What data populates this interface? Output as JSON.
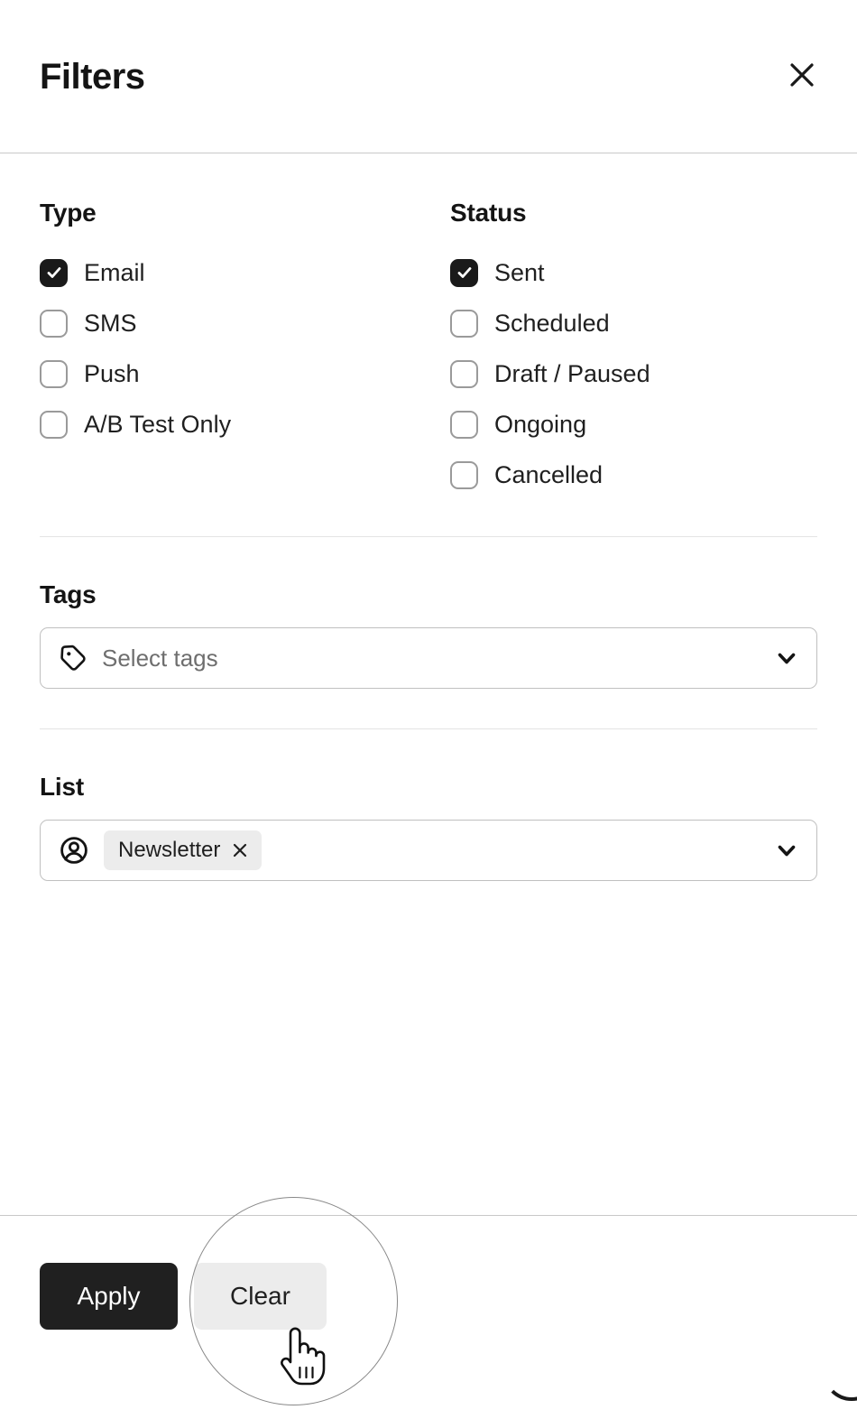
{
  "header": {
    "title": "Filters",
    "close_icon": "close-icon"
  },
  "filters": {
    "type": {
      "title": "Type",
      "options": [
        {
          "label": "Email",
          "checked": true
        },
        {
          "label": "SMS",
          "checked": false
        },
        {
          "label": "Push",
          "checked": false
        },
        {
          "label": "A/B Test Only",
          "checked": false
        }
      ]
    },
    "status": {
      "title": "Status",
      "options": [
        {
          "label": "Sent",
          "checked": true
        },
        {
          "label": "Scheduled",
          "checked": false
        },
        {
          "label": "Draft / Paused",
          "checked": false
        },
        {
          "label": "Ongoing",
          "checked": false
        },
        {
          "label": "Cancelled",
          "checked": false
        }
      ]
    },
    "tags": {
      "label": "Tags",
      "placeholder": "Select tags",
      "value": "",
      "icon": "tag-icon",
      "chevron_icon": "chevron-down-icon"
    },
    "list": {
      "label": "List",
      "icon": "user-circle-icon",
      "chevron_icon": "chevron-down-icon",
      "chips": [
        {
          "label": "Newsletter",
          "remove_icon": "chip-remove-icon"
        }
      ]
    }
  },
  "footer": {
    "apply_label": "Apply",
    "clear_label": "Clear"
  },
  "colors": {
    "accent": "#202020",
    "checkbox_checked": "#1a1a1a",
    "checkbox_border": "#9a9a9a",
    "chip_bg": "#ececec",
    "divider": "#e4e4e4",
    "header_divider": "#c9c9c9",
    "placeholder_text": "#6e6e6e"
  },
  "overlay": {
    "focus_ring": "cursor-focus-ring",
    "cursor": "pointer-hand-cursor"
  }
}
